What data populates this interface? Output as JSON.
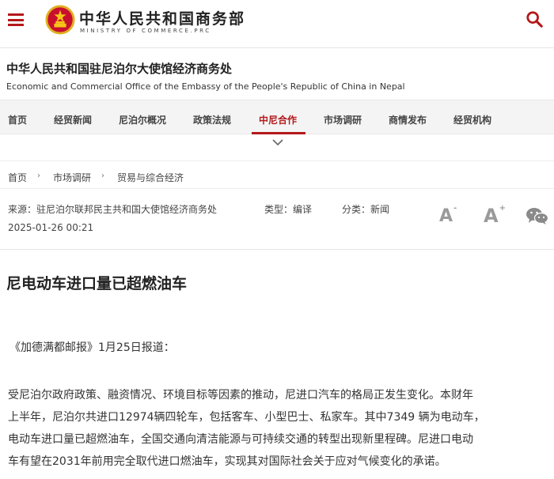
{
  "header": {
    "logo_cn": "中华人民共和国商务部",
    "logo_en": "MINISTRY OF COMMERCE.PRC"
  },
  "office": {
    "name_cn": "中华人民共和国驻尼泊尔大使馆经济商务处",
    "name_en": "Economic and Commercial Office of the Embassy of the People's Republic of China in Nepal"
  },
  "nav": {
    "items": [
      "首页",
      "经贸新闻",
      "尼泊尔概况",
      "政策法规",
      "中尼合作",
      "市场调研",
      "商情发布",
      "经贸机构"
    ],
    "active": "中尼合作"
  },
  "breadcrumb": [
    "首页",
    "市场调研",
    "贸易与综合经济"
  ],
  "meta": {
    "source": "来源：驻尼泊尔联邦民主共和国大使馆经济商务处",
    "type": "类型：编译",
    "category": "分类：新闻",
    "date": "2025-01-26 00:21",
    "font_small": "A",
    "font_large": "A"
  },
  "article": {
    "title": "尼电动车进口量已超燃油车",
    "source_line": "《加德满都邮报》1月25日报道：",
    "paragraph_lines": [
      "受尼泊尔政府政策、融资情况、环境目标等因素的推动，尼进口汽车的格局正发生变化。本财年",
      "上半年，尼泊尔共进口12974辆四轮车，包括客车、小型巴士、私家车。其中7349 辆为电动车，",
      "电动车进口量已超燃油车，全国交通向清洁能源与可持续交通的转型出现新里程碑。尼进口电动",
      "车有望在2031年前用完全取代进口燃油车，实现其对国际社会关于应对气候变化的承诺。"
    ]
  },
  "colors": {
    "brand_red": "#b4191c",
    "nav_bg": "#f4f4f4",
    "icon_gray": "#9a9a9a",
    "wechat_gray": "#8a8a8a"
  }
}
